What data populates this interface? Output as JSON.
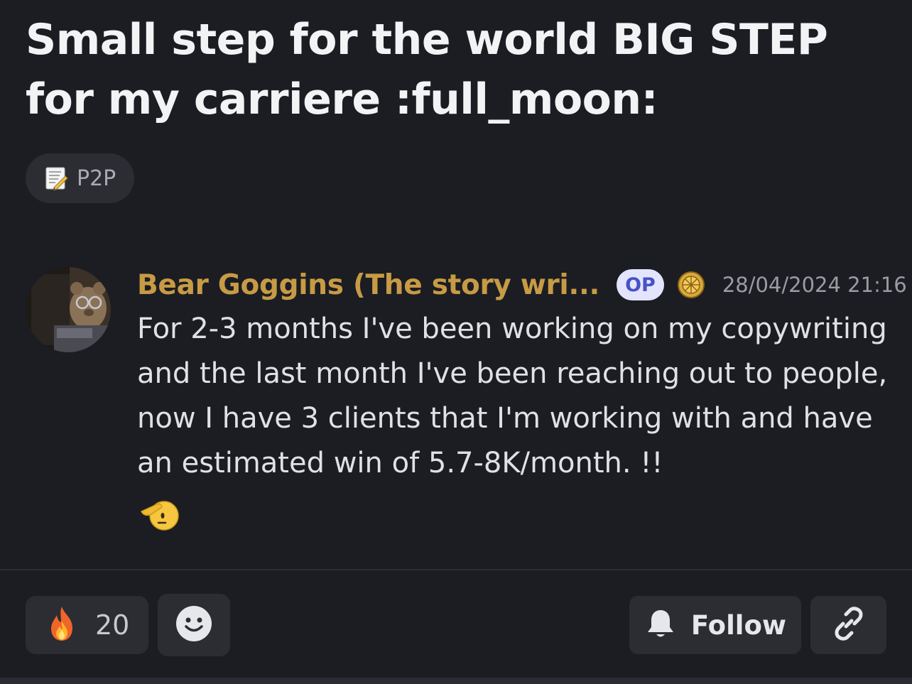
{
  "post": {
    "title": "Small step for the world BIG STEP for my carriere :full_moon:",
    "tag": {
      "icon": "memo-icon",
      "label": "P2P"
    }
  },
  "message": {
    "author": "Bear Goggins (The story wri...",
    "op_badge": "OP",
    "role_icon": "gold-badge-icon",
    "timestamp": "28/04/2024 21:16",
    "text": "For 2-3 months I've been working on my copywriting and the last month I've been reaching out to people, now I have 3 clients that I'm working with and have an estimated win of 5.7-8K/month. !!",
    "emoji": "saluting-face-icon"
  },
  "actions": {
    "reaction": {
      "icon": "fire-icon",
      "count": "20"
    },
    "add_reaction_icon": "smiley-icon",
    "follow_label": "Follow",
    "follow_icon": "bell-icon",
    "link_icon": "link-icon"
  },
  "colors": {
    "background": "#1b1d22",
    "author": "#c79a45",
    "op_badge_bg": "#e3e5ff",
    "op_badge_text": "#4752c4"
  }
}
